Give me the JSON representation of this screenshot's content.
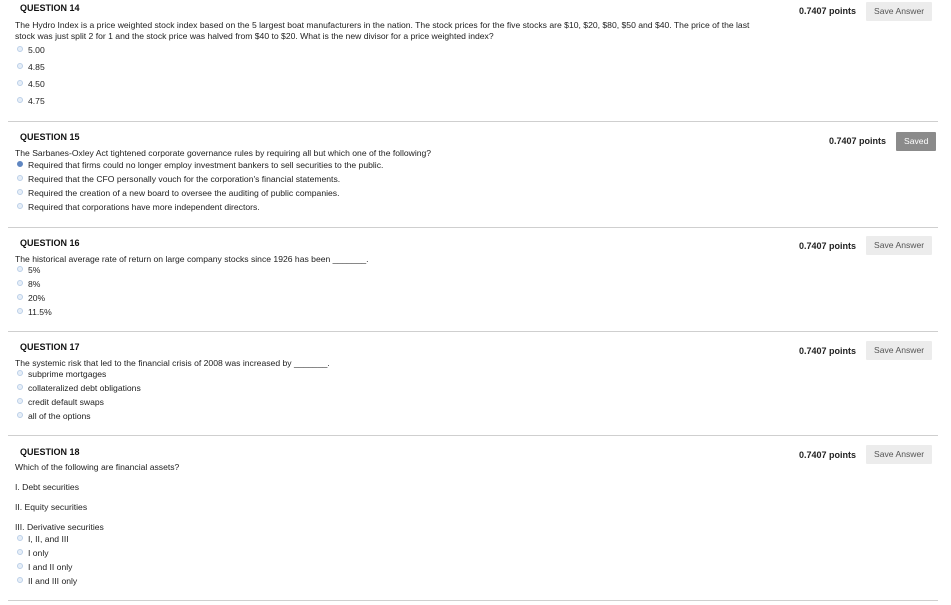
{
  "questions": [
    {
      "title": "QUESTION 14",
      "text": "The Hydro Index is a price weighted stock index based on the 5 largest boat manufacturers in the nation. The stock prices for the five stocks are $10, $20, $80, $50 and $40. The price of the last stock was just split 2 for 1 and the stock price was halved from $40 to $20. What is the new divisor for a price weighted index?",
      "points": "0.7407 points",
      "button": "Save Answer",
      "options": [
        "5.00",
        "4.85",
        "4.50",
        "4.75"
      ]
    },
    {
      "title": "QUESTION 15",
      "text": "The Sarbanes-Oxley Act tightened corporate governance rules by requiring all but which one of the following?",
      "points": "0.7407 points",
      "button": "Saved",
      "options": [
        "Required that firms could no longer employ investment bankers to sell securities to the public.",
        "Required that the CFO personally vouch for the corporation's financial statements.",
        "Required the creation of a new board to oversee the auditing of public companies.",
        "Required that corporations have more independent directors."
      ]
    },
    {
      "title": "QUESTION 16",
      "text": "The historical average rate of return on large company stocks since 1926 has been _______.",
      "points": "0.7407 points",
      "button": "Save Answer",
      "options": [
        "5%",
        "8%",
        "20%",
        "11.5%"
      ]
    },
    {
      "title": "QUESTION 17",
      "text": "The systemic risk that led to the financial crisis of 2008 was increased by _______.",
      "points": "0.7407 points",
      "button": "Save Answer",
      "options": [
        "subprime mortgages",
        "collateralized debt obligations",
        "credit default swaps",
        "all of the options"
      ]
    },
    {
      "title": "QUESTION 18",
      "text": "Which of the following are financial assets?",
      "points": "0.7407 points",
      "button": "Save Answer",
      "statements": [
        "I. Debt securities",
        "II. Equity securities",
        "III. Derivative securities"
      ],
      "options": [
        "I, II, and III",
        "I only",
        "I and II only",
        "II and III only"
      ]
    }
  ]
}
